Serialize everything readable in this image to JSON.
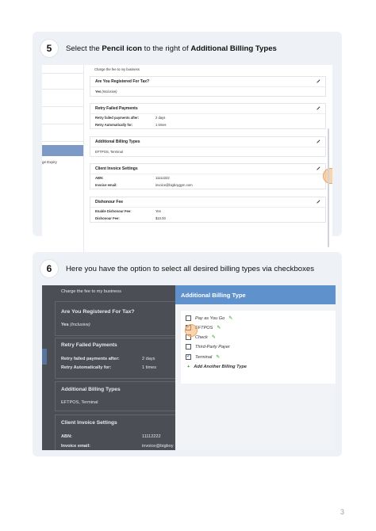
{
  "step5": {
    "number": "5",
    "text_before": "Select the ",
    "bold1": "Pencil icon",
    "text_mid": " to the right of ",
    "bold2": "Additional Billing Types",
    "screenshot": {
      "left_panel_item": "ge Expiry",
      "fee_note": "Charge the fee to my business",
      "tax": {
        "title": "Are You Registered For Tax?",
        "value": "Yes",
        "value_note": "(Inclusive)"
      },
      "retry": {
        "title": "Retry Failed Payments",
        "rows": [
          {
            "k": "Retry failed payments after:",
            "v": "2 days"
          },
          {
            "k": "Retry Automatically for:",
            "v": "1 times"
          }
        ]
      },
      "billing": {
        "title": "Additional Billing Types",
        "value": "EFTPOS, Terminal"
      },
      "invoice": {
        "title": "Client Invoice Settings",
        "rows": [
          {
            "k": "ABN:",
            "v": "11112222"
          },
          {
            "k": "Invoice email:",
            "v": "invoice@bigboygym.com"
          }
        ]
      },
      "dishonour": {
        "title": "Dishonour Fee",
        "rows": [
          {
            "k": "Enable Dishonour Fee:",
            "v": "Yes"
          },
          {
            "k": "Dishonour Fee:",
            "v": "$10.00"
          }
        ]
      }
    }
  },
  "step6": {
    "number": "6",
    "text": "Here you have the option to select all desired billing types via checkboxes",
    "screenshot": {
      "fee_note": "Charge the fee to my business",
      "tax_title": "Are You Registered For Tax?",
      "tax_value": "Yes",
      "tax_note": "(Inclusive)",
      "retry_title": "Retry Failed Payments",
      "retry_rows": [
        {
          "k": "Retry failed payments after:",
          "v": "2 days"
        },
        {
          "k": "Retry Automatically for:",
          "v": "1 times"
        }
      ],
      "billing_title": "Additional Billing Types",
      "billing_value": "EFTPOS, Terminal",
      "invoice_title": "Client Invoice Settings",
      "abn_label": "ABN:",
      "abn_value": "11112222",
      "email_label": "Invoice email:",
      "email_value": "invoice@bigboy",
      "panel_title": "Additional Billing Type",
      "options": [
        {
          "label": "Pay as You Go",
          "checked": false
        },
        {
          "label": "EFTPOS",
          "checked": true
        },
        {
          "label": "Check",
          "checked": false
        },
        {
          "label": "Third-Party Payer",
          "checked": false
        },
        {
          "label": "Terminal",
          "checked": true
        }
      ],
      "add_label": "Add Another Billing Type"
    }
  },
  "page_number": "3",
  "colors": {
    "panel_header": "#5f91cc",
    "highlight": "#f0a35a",
    "pencil_green": "#2e9a2e"
  }
}
